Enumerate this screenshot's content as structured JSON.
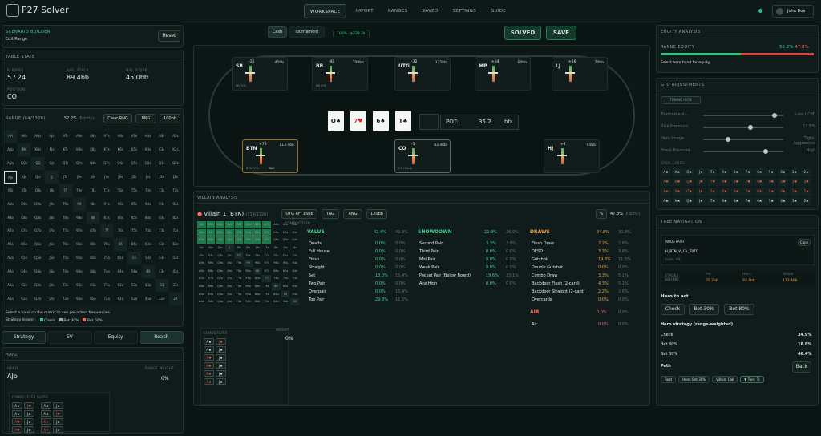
{
  "app": {
    "title": "P27 Solver",
    "user": "John Doe"
  },
  "nav": [
    "WORKSPACE",
    "IMPORT",
    "RANGES",
    "SAVED",
    "SETTINGS",
    "GUIDE"
  ],
  "scenario": {
    "title": "SCENARIO BUILDER",
    "subtitle": "Edit Range",
    "reset": "Reset"
  },
  "table_state": {
    "title": "TABLE STATE",
    "players_label": "PLAYERS",
    "players": "5 / 24",
    "avg_label": "AVG. STACK",
    "avg": "89.4bb",
    "min_label": "MIN. STACK",
    "min": "45.0bb",
    "position_label": "POSITION",
    "position": "CO"
  },
  "range": {
    "title": "RANGE (84/1326)",
    "equity": "52.2%",
    "equity_label": "(Equity)",
    "clear": "Clear RNG",
    "rng": "RNG",
    "pct": "100bb",
    "rows": [
      [
        "AA",
        "AKs",
        "AQs",
        "AJs",
        "ATs",
        "A9s",
        "A8s",
        "A7s",
        "A6s",
        "A5s",
        "A4s",
        "A3s",
        "A2s"
      ],
      [
        "AKo",
        "KK",
        "KQs",
        "KJs",
        "KTs",
        "K9s",
        "K8s",
        "K7s",
        "K6s",
        "K5s",
        "K4s",
        "K3s",
        "K2s"
      ],
      [
        "AQo",
        "KQo",
        "QQ",
        "QJs",
        "QTs",
        "Q9s",
        "Q8s",
        "Q7s",
        "Q6s",
        "Q5s",
        "Q4s",
        "Q3s",
        "Q2s"
      ],
      [
        "AJo",
        "KJo",
        "QJo",
        "JJ",
        "JTs",
        "J9s",
        "J8s",
        "J7s",
        "J6s",
        "J5s",
        "J4s",
        "J3s",
        "J2s"
      ],
      [
        "ATo",
        "KTo",
        "QTo",
        "JTo",
        "TT",
        "T9s",
        "T8s",
        "T7s",
        "T6s",
        "T5s",
        "T4s",
        "T3s",
        "T2s"
      ],
      [
        "A9o",
        "K9o",
        "Q9o",
        "J9o",
        "T9o",
        "99",
        "98s",
        "97s",
        "96s",
        "95s",
        "94s",
        "93s",
        "92s"
      ],
      [
        "A8o",
        "K8o",
        "Q8o",
        "J8o",
        "T8o",
        "98o",
        "88",
        "87s",
        "86s",
        "85s",
        "84s",
        "83s",
        "82s"
      ],
      [
        "A7o",
        "K7o",
        "Q7o",
        "J7o",
        "T7o",
        "97o",
        "87o",
        "77",
        "76s",
        "75s",
        "74s",
        "73s",
        "72s"
      ],
      [
        "A6o",
        "K6o",
        "Q6o",
        "J6o",
        "T6o",
        "96o",
        "86o",
        "76o",
        "66",
        "65s",
        "64s",
        "63s",
        "62s"
      ],
      [
        "A5o",
        "K5o",
        "Q5o",
        "J5o",
        "T5o",
        "95o",
        "85o",
        "75o",
        "65o",
        "55",
        "54s",
        "53s",
        "52s"
      ],
      [
        "A4o",
        "K4o",
        "Q4o",
        "J4o",
        "T4o",
        "94o",
        "84o",
        "74o",
        "64o",
        "54o",
        "44",
        "43s",
        "42s"
      ],
      [
        "A3o",
        "K3o",
        "Q3o",
        "J3o",
        "T3o",
        "93o",
        "83o",
        "73o",
        "63o",
        "53o",
        "43o",
        "33",
        "32s"
      ],
      [
        "A2o",
        "K2o",
        "Q2o",
        "J2o",
        "T2o",
        "92o",
        "82o",
        "72o",
        "62o",
        "52o",
        "42o",
        "32o",
        "22"
      ]
    ],
    "hint": "Select a hand on the matrix to see per-action frequencies.",
    "legend_label": "Strategy legend:",
    "legend": [
      {
        "label": "Check",
        "color": "#2ec27e"
      },
      {
        "label": "Bet 30%",
        "color": "#9aa8a5"
      },
      {
        "label": "Bet 60%",
        "color": "#ff6b4a"
      }
    ]
  },
  "left_tabs": [
    "Strategy",
    "EV",
    "Equity",
    "Reach"
  ],
  "hand": {
    "title": "HAND",
    "hand_label": "HAND",
    "hand": "AJo",
    "weight_label": "RANGE WEIGHT",
    "weight": "0%",
    "combo_title": "COMBO FILTER (SUITS)",
    "combos": [
      [
        "A♠",
        "J♥",
        "A♣",
        "J♠"
      ],
      [
        "A♠",
        "J♣",
        "A♣",
        "J♥"
      ],
      [
        "A♥",
        "J♠",
        "A♦",
        "J♣"
      ],
      [
        "A♥",
        "J♣",
        "A♦",
        "J♠"
      ]
    ]
  },
  "center": {
    "cash": "Cash",
    "tournament": "Tournament",
    "badge": "100% · $239.2k",
    "solved": "SOLVED",
    "save": "SAVE"
  },
  "seats": [
    {
      "pos": "SB",
      "delta": "-16",
      "stack": "45bb",
      "sub": "SB (V2)"
    },
    {
      "pos": "BB",
      "delta": "-40",
      "stack": "100bb",
      "sub": "BB (V3)"
    },
    {
      "pos": "UTG",
      "delta": "-32",
      "stack": "125bb",
      "sub": ""
    },
    {
      "pos": "MP",
      "delta": "+64",
      "stack": "60bb",
      "sub": ""
    },
    {
      "pos": "LJ",
      "delta": "+16",
      "stack": "70bb",
      "sub": ""
    },
    {
      "pos": "BTN",
      "delta": "+76",
      "stack": "113.4bb",
      "sub": "BTN (V1)",
      "tag": "TAG"
    },
    {
      "pos": "CO",
      "delta": "-1",
      "stack": "83.4bb",
      "sub": "CO (Hero)"
    },
    {
      "pos": "HJ",
      "delta": "+4",
      "stack": "95bb",
      "sub": ""
    }
  ],
  "board": [
    {
      "rank": "Q",
      "suit": "♠",
      "color": "#111"
    },
    {
      "rank": "7",
      "suit": "♥",
      "color": "#d22"
    },
    {
      "rank": "6",
      "suit": "♠",
      "color": "#111"
    },
    {
      "rank": "T",
      "suit": "♣",
      "color": "#111"
    }
  ],
  "pot": {
    "label": "POT:",
    "value": "35.2",
    "unit": "bb"
  },
  "villain": {
    "title": "VILLAIN ANALYSIS",
    "name": "Villain 1 (BTN)",
    "combos": "(114/1326)",
    "tag1": "UTG RFI 15bb",
    "tag2": "TAG",
    "tag3": "RNG",
    "tag4": "120bb",
    "pct": "%",
    "equity": "47.8%",
    "equity_label": "(Equity)",
    "comp_title": "COMPOSITION",
    "combo_filter": "COMBO FILTER",
    "weight_label": "WEIGHT",
    "weight": "0%",
    "mini_rows": [
      [
        "AA",
        "AKs",
        "AQs",
        "AJs",
        "ATs",
        "A9s",
        "A8s",
        "A7s",
        "A6s",
        "A5s",
        "A4s"
      ],
      [
        "AKo",
        "KK",
        "KQs",
        "KJs",
        "KTs",
        "K9s",
        "K8s",
        "K7s",
        "K6s",
        "K5s",
        "K4s"
      ],
      [
        "AQo",
        "KQo",
        "QQ",
        "QJs",
        "QTs",
        "Q9s",
        "Q8s",
        "Q7s",
        "Q6s",
        "Q5s",
        "Q4s"
      ],
      [
        "AJo",
        "KJo",
        "QJo",
        "JJ",
        "JTs",
        "J9s",
        "J8s",
        "J7s",
        "J6s",
        "J5s",
        "J4s"
      ],
      [
        "ATo",
        "KTo",
        "QTo",
        "JTo",
        "TT",
        "T9s",
        "T8s",
        "T7s",
        "T6s",
        "T5s",
        "T4s"
      ],
      [
        "A9o",
        "K9o",
        "Q9o",
        "J9o",
        "T9o",
        "99",
        "98s",
        "97s",
        "96s",
        "95s",
        "94s"
      ],
      [
        "A8o",
        "K8o",
        "Q8o",
        "J8o",
        "T8o",
        "98o",
        "88",
        "87s",
        "86s",
        "85s",
        "84s"
      ],
      [
        "A7o",
        "K7o",
        "Q7o",
        "J7o",
        "T7o",
        "97o",
        "87o",
        "77",
        "76s",
        "75s",
        "74s"
      ],
      [
        "A6o",
        "K6o",
        "Q6o",
        "J6o",
        "T6o",
        "96o",
        "86o",
        "76o",
        "66",
        "65s",
        "64s"
      ],
      [
        "A5o",
        "K5o",
        "Q5o",
        "J5o",
        "T5o",
        "95o",
        "85o",
        "75o",
        "65o",
        "55",
        "54s"
      ],
      [
        "A4o",
        "K4o",
        "Q4o",
        "J4o",
        "T4o",
        "94o",
        "84o",
        "74o",
        "64o",
        "54o",
        "44"
      ]
    ],
    "filter_combos": [
      [
        "A♠",
        "J♥"
      ],
      [
        "A♠",
        "J♣"
      ],
      [
        "A♥",
        "J♠"
      ],
      [
        "A♥",
        "J♣"
      ],
      [
        "A♦",
        "J♠"
      ],
      [
        "A♦",
        "J♣"
      ]
    ],
    "value": {
      "title": "VALUE",
      "a": "42.4%",
      "b": "42.3%",
      "rows": [
        [
          "Quads",
          "0.0%",
          "0.0%"
        ],
        [
          "Full House",
          "0.0%",
          "0.0%"
        ],
        [
          "Flush",
          "0.0%",
          "0.0%"
        ],
        [
          "Straight",
          "0.0%",
          "0.0%"
        ],
        [
          "Set",
          "13.0%",
          "15.4%"
        ],
        [
          "Two Pair",
          "0.0%",
          "0.0%"
        ],
        [
          "Overpair",
          "0.0%",
          "15.4%"
        ],
        [
          "Top Pair",
          "29.3%",
          "11.5%"
        ]
      ]
    },
    "showdown": {
      "title": "SHOWDOWN",
      "a": "22.8%",
      "b": "26.9%",
      "rows": [
        [
          "Second Pair",
          "3.3%",
          "3.8%"
        ],
        [
          "Third Pair",
          "0.0%",
          "0.0%"
        ],
        [
          "Mid Pair",
          "0.0%",
          "0.0%"
        ],
        [
          "Weak Pair",
          "0.0%",
          "0.0%"
        ],
        [
          "Pocket Pair (Below Board)",
          "19.6%",
          "23.1%"
        ],
        [
          "Ace High",
          "0.0%",
          "0.0%"
        ]
      ]
    },
    "draws": {
      "title": "DRAWS",
      "a": "34.8%",
      "b": "30.8%",
      "rows": [
        [
          "Flush Draw",
          "2.2%",
          "2.6%"
        ],
        [
          "OESD",
          "3.3%",
          "3.8%"
        ],
        [
          "Gutshot",
          "19.6%",
          "11.5%"
        ],
        [
          "Double Gutshot",
          "0.0%",
          "0.0%"
        ],
        [
          "Combo Draw",
          "3.3%",
          "5.1%"
        ],
        [
          "Backdoor Flush (2-card)",
          "4.3%",
          "5.1%"
        ],
        [
          "Backdoor Straight (2-card)",
          "2.2%",
          "2.6%"
        ],
        [
          "Overcards",
          "0.0%",
          "0.0%"
        ]
      ]
    },
    "air": {
      "title": "AIR",
      "a": "0.0%",
      "b": "0.0%",
      "row": [
        "Air",
        "0.0%",
        "0.0%"
      ]
    }
  },
  "equity_analysis": {
    "title": "EQUITY ANALYSIS",
    "label": "RANGE EQUITY",
    "hero": "52.2%",
    "villain": "47.8%",
    "hint": "Select hero hand for equity"
  },
  "gto": {
    "title": "GTO ADJUSTMENTS",
    "tag": "TUNING ICON",
    "sliders": [
      {
        "label": "Tournament...",
        "value": "Late (ICM)",
        "pos": 0.92
      },
      {
        "label": "Risk Premium",
        "value": "12.5%",
        "pos": 0.6
      },
      {
        "label": "Hero Image",
        "value": "Tight-Aggressive",
        "pos": 0.3
      },
      {
        "label": "Stack Pressure",
        "value": "High",
        "pos": 0.8
      }
    ],
    "open_cards": "OPEN CARDS",
    "cards": [
      [
        "A♠",
        "K♠",
        "Q♠",
        "J♠",
        "T♠",
        "9♠",
        "8♠",
        "7♠",
        "6♠",
        "5♠",
        "4♠",
        "3♠",
        "2♠"
      ],
      [
        "A♥",
        "K♥",
        "Q♥",
        "J♥",
        "T♥",
        "9♥",
        "8♥",
        "7♥",
        "6♥",
        "5♥",
        "4♥",
        "3♥",
        "2♥"
      ],
      [
        "A♦",
        "K♦",
        "Q♦",
        "J♦",
        "T♦",
        "9♦",
        "8♦",
        "7♦",
        "6♦",
        "5♦",
        "4♦",
        "3♦",
        "2♦"
      ],
      [
        "A♣",
        "K♣",
        "Q♣",
        "J♣",
        "T♣",
        "9♣",
        "8♣",
        "7♣",
        "6♣",
        "5♣",
        "4♣",
        "3♣",
        "2♣"
      ]
    ]
  },
  "tree": {
    "title": "TREE NAVIGATION",
    "node_path_label": "NODE PATH",
    "copy": "Copy",
    "node_path": "H_BTN_V_CA_TUTC",
    "node_sub": "node: #8",
    "stacks_label": "STACKS BEHIND",
    "pot_label": "Pot",
    "pot": "35.2bb",
    "hero_label": "Hero",
    "hero": "93.4bb",
    "villain_label": "Villain",
    "villain": "113.4bb",
    "hero_to_act": "Hero to act",
    "actions": [
      "Check",
      "Bet 30%",
      "Bet 80%"
    ],
    "strategy_title": "Hero strategy (range-weighted)",
    "strategy": [
      [
        "Check",
        "34.9%"
      ],
      [
        "Bet 30%",
        "18.8%"
      ],
      [
        "Bet 80%",
        "46.4%"
      ]
    ],
    "path": "Path",
    "back": "Back",
    "path_items": [
      "Root",
      "Hero: Bet 30%",
      "Villain: Call",
      "▼ Turn: Tc"
    ]
  }
}
